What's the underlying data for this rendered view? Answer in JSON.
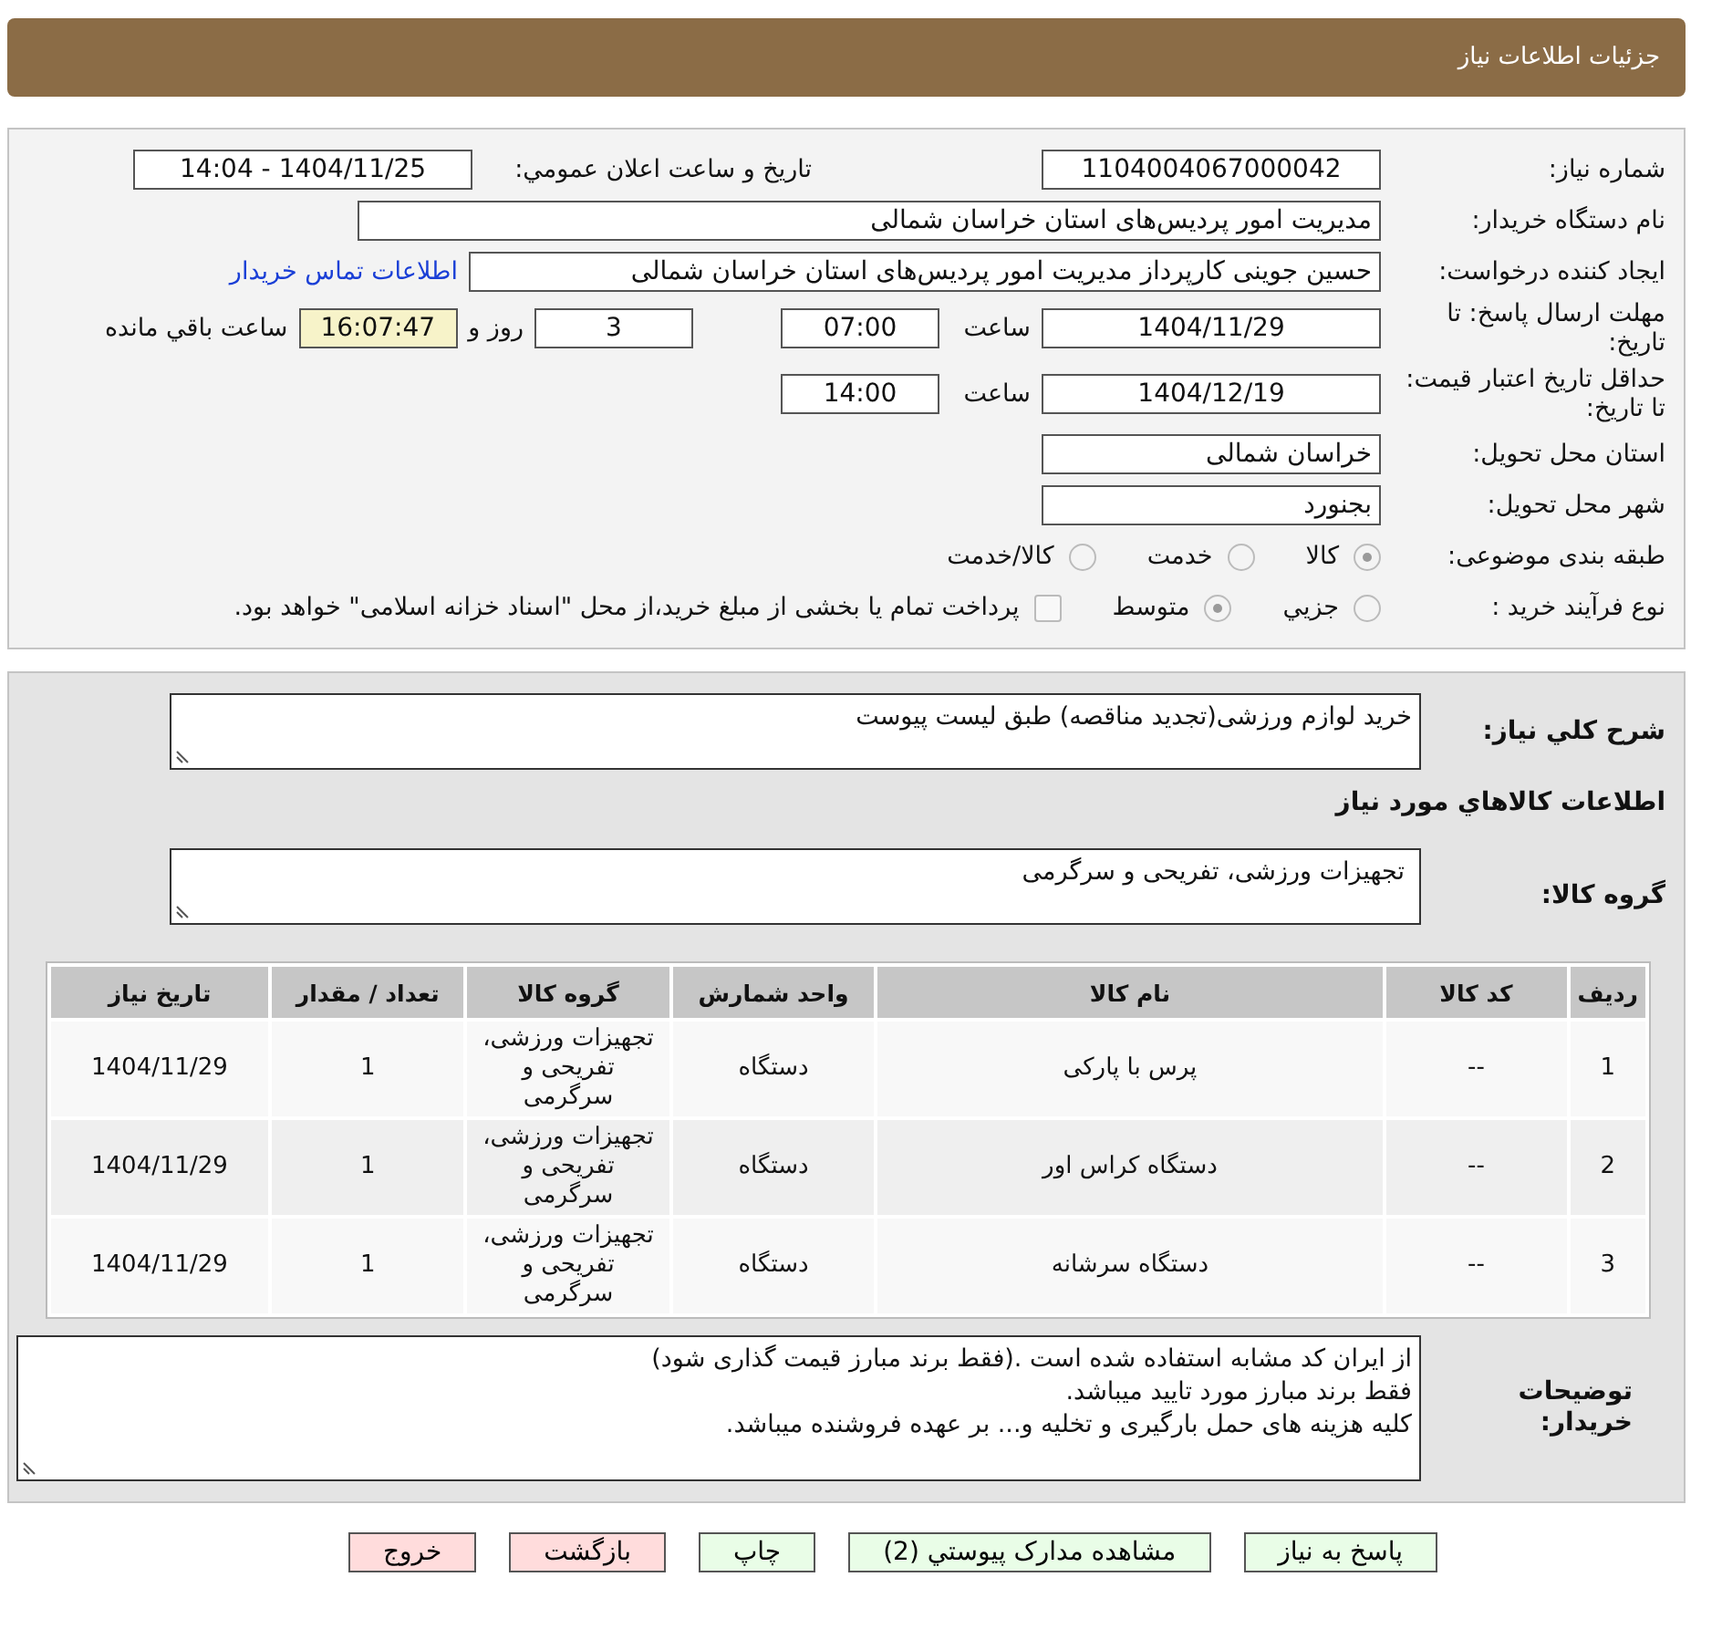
{
  "header": {
    "title": "جزئیات اطلاعات نیاز"
  },
  "details": {
    "need_number": {
      "label": "شماره نیاز:",
      "value": "1104004067000042"
    },
    "announce": {
      "label": "تاریخ و ساعت اعلان عمومي:",
      "value": "1404/11/25 - 14:04"
    },
    "buyer": {
      "label": "نام دستگاه خریدار:",
      "value": "مدیریت امور پردیس‌های استان خراسان شمالی"
    },
    "creator": {
      "label": "ایجاد کننده درخواست:",
      "value": "حسین جوینی کارپرداز مدیریت امور پردیس‌های استان خراسان شمالی",
      "link": "اطلاعات تماس خریدار"
    },
    "deadline": {
      "label": "مهلت ارسال پاسخ: تا تاریخ:",
      "date": "1404/11/29",
      "time_label": "ساعت",
      "time": "07:00",
      "days": "3",
      "days_label": "روز و",
      "remaining": "16:07:47",
      "remaining_label": "ساعت باقي مانده"
    },
    "validity": {
      "label": "حداقل تاریخ اعتبار قیمت: تا تاریخ:",
      "date": "1404/12/19",
      "time_label": "ساعت",
      "time": "14:00"
    },
    "province": {
      "label": "استان محل تحویل:",
      "value": "خراسان شمالی"
    },
    "city": {
      "label": "شهر محل تحویل:",
      "value": "بجنورد"
    },
    "category": {
      "label": "طبقه بندی موضوعی:",
      "options": [
        {
          "label": "کالا",
          "selected": true
        },
        {
          "label": "خدمت",
          "selected": false
        },
        {
          "label": "کالا/خدمت",
          "selected": false
        }
      ]
    },
    "purchase_type": {
      "label": "نوع فرآیند خرید :",
      "options": [
        {
          "label": "جزيي",
          "selected": false
        },
        {
          "label": "متوسط",
          "selected": true
        }
      ],
      "treasury": {
        "checked": false,
        "label": "پرداخت تمام یا بخشی از مبلغ خرید،از محل \"اسناد خزانه اسلامی\" خواهد بود."
      }
    }
  },
  "summary": {
    "label": "شرح کلي نیاز:",
    "value": "خرید لوازم ورزشی(تجدید مناقصه) طبق لیست پیوست"
  },
  "goods_heading": "اطلاعات کالاهاي مورد نیاز",
  "goods_group": {
    "label": "گروه کالا:",
    "value": "تجهیزات ورزشی، تفریحی و سرگرمی"
  },
  "table": {
    "columns": [
      "ردیف",
      "کد کالا",
      "نام کالا",
      "واحد شمارش",
      "گروه کالا",
      "تعداد / مقدار",
      "تاریخ نیاز"
    ],
    "rows": [
      [
        "1",
        "--",
        "پرس با پارکی",
        "دستگاه",
        "تجهیزات ورزشی، تفریحی و سرگرمی",
        "1",
        "1404/11/29"
      ],
      [
        "2",
        "--",
        "دستگاه کراس اور",
        "دستگاه",
        "تجهیزات ورزشی، تفریحی و سرگرمی",
        "1",
        "1404/11/29"
      ],
      [
        "3",
        "--",
        "دستگاه سرشانه",
        "دستگاه",
        "تجهیزات ورزشی، تفریحی و سرگرمی",
        "1",
        "1404/11/29"
      ]
    ]
  },
  "notes": {
    "label": "توضیحات خریدار:",
    "value": "از ایران کد مشابه استفاده شده است .(فقط برند مبارز قیمت گذاری شود)\nفقط برند مبارز مورد تایید میباشد.\nکلیه هزینه های حمل بارگیری و تخلیه و... بر عهده فروشنده میباشد."
  },
  "buttons": [
    {
      "label": "پاسخ به نیاز",
      "kind": "green"
    },
    {
      "label": "مشاهده مدارک پیوستي (2)",
      "kind": "green"
    },
    {
      "label": "چاپ",
      "kind": "green"
    },
    {
      "label": "بازگشت",
      "kind": "red"
    },
    {
      "label": "خروج",
      "kind": "red"
    }
  ]
}
